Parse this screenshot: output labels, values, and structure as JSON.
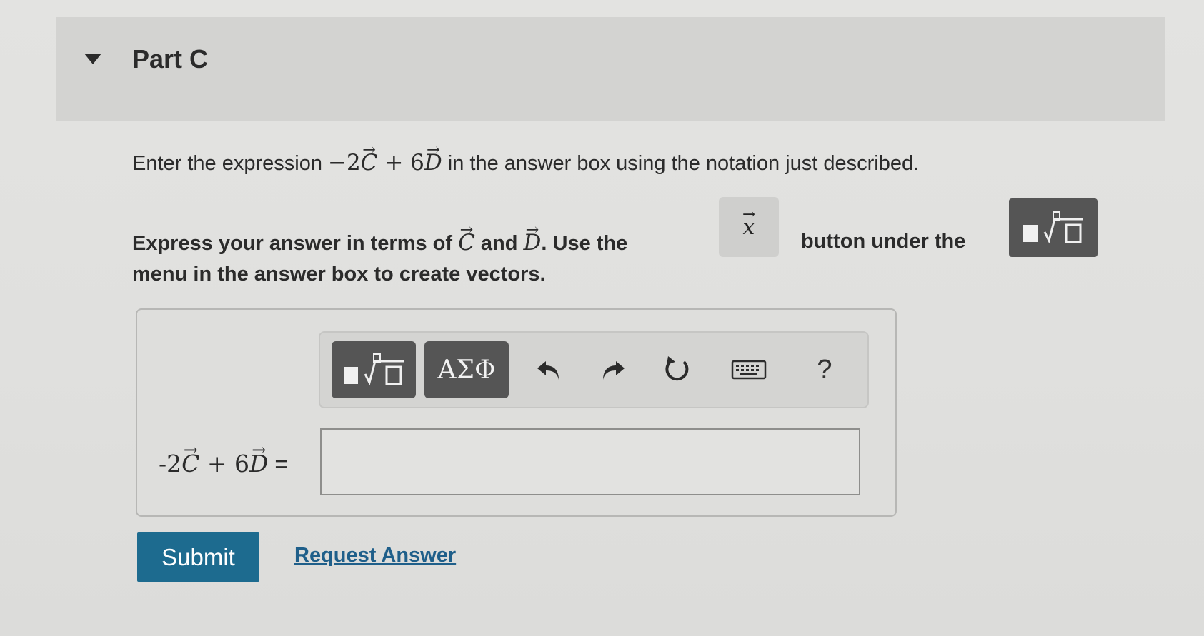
{
  "part": {
    "title": "Part C",
    "toggle_icon": "caret-down-icon"
  },
  "instruction": {
    "before": "Enter the expression ",
    "coef1": "−2",
    "vec1": "C",
    "plus": " + 6",
    "vec2": "D",
    "after": " in the answer box using the notation just described."
  },
  "express": {
    "line1_start": "Express your answer in terms of ",
    "vec_c": "C",
    "and": " and ",
    "vec_d": "D",
    "use_the": ". Use the",
    "vector_button_symbol": "x",
    "button_under_the": "button under the",
    "line2": "menu in the answer box to create vectors."
  },
  "toolbar": {
    "greek_label": "ΑΣΦ",
    "help_label": "?",
    "icons": [
      "template-icon",
      "undo-icon",
      "redo-icon",
      "reset-icon",
      "keyboard-icon",
      "help-icon"
    ]
  },
  "equation": {
    "coef1": "-2",
    "vec1": "C",
    "plus": " + 6",
    "vec2": "D",
    "equals": " ="
  },
  "answer": {
    "value": "",
    "placeholder": ""
  },
  "actions": {
    "submit_label": "Submit",
    "request_label": "Request Answer"
  },
  "colors": {
    "submit_bg": "#1d6b8f",
    "toolbar_button_bg": "#555555",
    "link": "#1f5f8a"
  }
}
